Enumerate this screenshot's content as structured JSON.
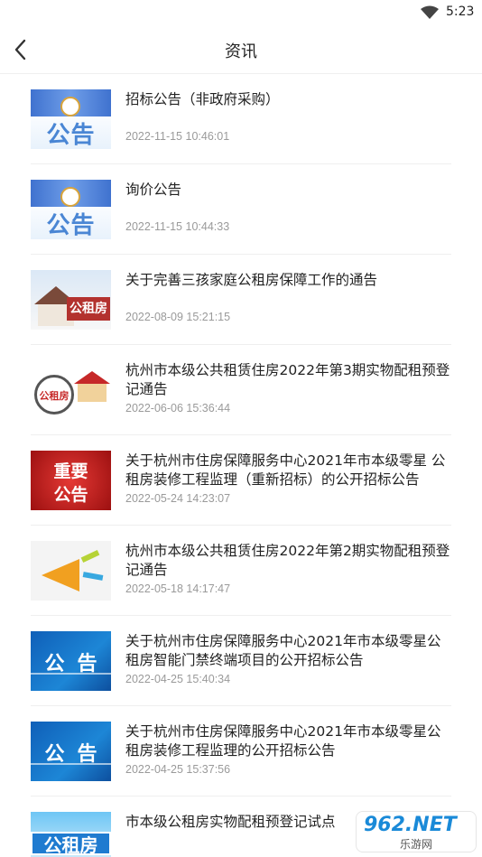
{
  "status_bar": {
    "time": "5:23",
    "wifi_icon": "wifi-icon"
  },
  "header": {
    "title": "资讯",
    "back_icon": "chevron-left-icon"
  },
  "news": [
    {
      "title": "招标公告（非政府采购）",
      "date": "2022-11-15 10:46:01",
      "thumb": "notice",
      "thumb_text": "公告"
    },
    {
      "title": "询价公告",
      "date": "2022-11-15 10:44:33",
      "thumb": "notice",
      "thumb_text": "公告"
    },
    {
      "title": "关于完善三孩家庭公租房保障工作的通告",
      "date": "2022-08-09 15:21:15",
      "thumb": "house",
      "thumb_text": "公租房"
    },
    {
      "title": "杭州市本级公共租赁住房2022年第3期实物配租预登记通告",
      "date": "2022-06-06 15:36:44",
      "thumb": "circle",
      "thumb_text": "公租房"
    },
    {
      "title": "关于杭州市住房保障服务中心2021年市本级零星 公租房装修工程监理（重新招标）的公开招标公告",
      "date": "2022-05-24 14:23:07",
      "thumb": "important",
      "thumb_text": [
        "重要",
        "公告"
      ]
    },
    {
      "title": "杭州市本级公共租赁住房2022年第2期实物配租预登记通告",
      "date": "2022-05-18 14:17:47",
      "thumb": "horn"
    },
    {
      "title": "关于杭州市住房保障服务中心2021年市本级零星公租房智能门禁终端项目的公开招标公告",
      "date": "2022-04-25 15:40:34",
      "thumb": "blue",
      "thumb_text": "公告"
    },
    {
      "title": "关于杭州市住房保障服务中心2021年市本级零星公租房装修工程监理的公开招标公告",
      "date": "2022-04-25 15:37:56",
      "thumb": "blue",
      "thumb_text": "公告"
    },
    {
      "title": "市本级公租房实物配租预登记试点",
      "date": "",
      "thumb": "gzf",
      "thumb_text": "公租房"
    }
  ],
  "watermark": {
    "main": "962.NET",
    "sub": "乐游网"
  }
}
